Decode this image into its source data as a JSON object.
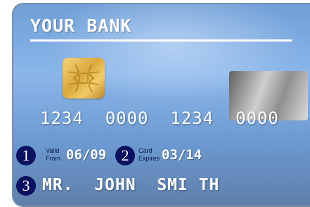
{
  "card": {
    "bank_name": "YOUR BANK",
    "number": "1234  0000  1234  0000",
    "valid_from_label_1": "Valid",
    "valid_from_label_2": "From",
    "valid_from_value": "06/09",
    "expires_label_1": "Card",
    "expires_label_2": "Expires",
    "expires_value": "03/14",
    "holder_name": "MR.  JOHN  SMI TH",
    "badges": [
      "1",
      "2",
      "3"
    ]
  }
}
